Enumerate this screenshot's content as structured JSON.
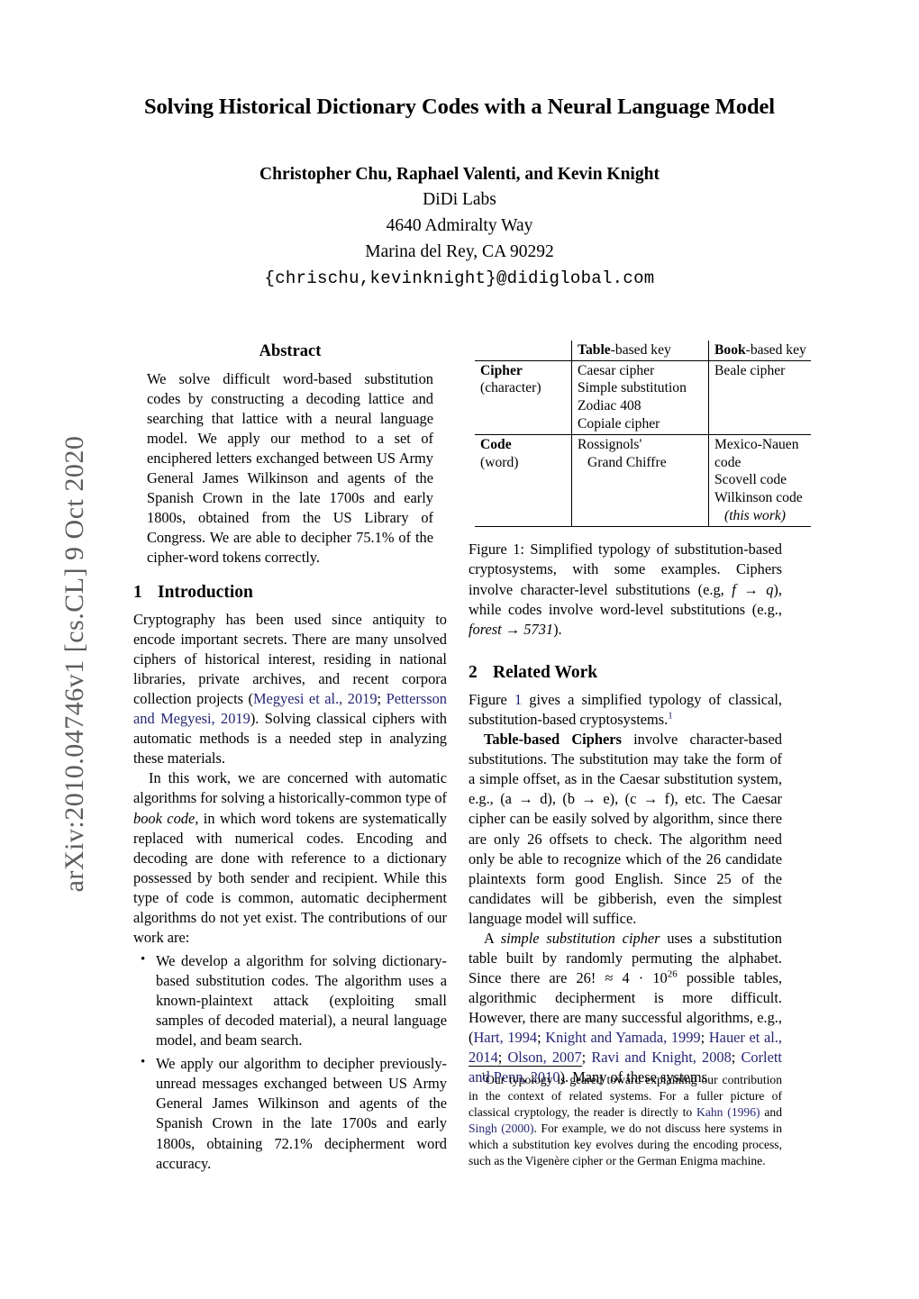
{
  "arxiv_stamp": "arXiv:2010.04746v1  [cs.CL]  9 Oct 2020",
  "title": "Solving Historical Dictionary Codes with a Neural Language Model",
  "authors": {
    "names": "Christopher Chu, Raphael Valenti, and Kevin Knight",
    "org": "DiDi Labs",
    "street": "4640 Admiralty Way",
    "city": "Marina del Rey, CA 90292",
    "email": "{chrischu,kevinknight}@didiglobal.com"
  },
  "abstract": {
    "heading": "Abstract",
    "body": "We solve difficult word-based substitution codes by constructing a decoding lattice and searching that lattice with a neural language model. We apply our method to a set of enciphered letters exchanged between US Army General James Wilkinson and agents of the Spanish Crown in the late 1700s and early 1800s, obtained from the US Library of Congress. We are able to decipher 75.1% of the cipher-word tokens correctly."
  },
  "sections": {
    "intro": {
      "number": "1",
      "title": "Introduction",
      "para1_a": "Cryptography has been used since antiquity to encode important secrets. There are many unsolved ciphers of historical interest, residing in national libraries, private archives, and recent corpora collection projects (",
      "para1_cite1": "Megyesi et al., 2019",
      "para1_sep": "; ",
      "para1_cite2": "Pettersson and Megyesi, 2019",
      "para1_b": "). Solving classical ciphers with automatic methods is a needed step in analyzing these materials.",
      "para2_a": "In this work, we are concerned with automatic algorithms for solving a historically-common type of ",
      "para2_em": "book code",
      "para2_b": ", in which word tokens are systematically replaced with numerical codes. Encoding and decoding are done with reference to a dictionary possessed by both sender and recipient. While this type of code is common, automatic decipherment algorithms do not yet exist. The contributions of our work are:",
      "bullets": [
        "We develop a algorithm for solving dictionary-based substitution codes. The algorithm uses a known-plaintext attack (exploiting small samples of decoded material), a neural language model, and beam search.",
        "We apply our algorithm to decipher previously-unread messages exchanged between US Army General James Wilkinson and agents of the Spanish Crown in the late 1700s and early 1800s, obtaining 72.1% decipherment word accuracy."
      ]
    },
    "related": {
      "number": "2",
      "title": "Related Work",
      "para1_a": "Figure ",
      "para1_ref": "1",
      "para1_b": " gives a simplified typology of classical, substitution-based cryptosystems.",
      "para1_fn": "1",
      "para2_lead": "Table-based Ciphers",
      "para2_a": " involve character-based substitutions. The substitution may take the form of a simple offset, as in the Caesar substitution system, e.g., (a → d), (b → e), (c → f), etc. The Caesar cipher can be easily solved by algorithm, since there are only 26 offsets to check. The algorithm need only be able to recognize which of the 26 candidate plaintexts form good English. Since 25 of the candidates will be gibberish, even the simplest language model will suffice.",
      "para3_a": "A ",
      "para3_em": "simple substitution cipher",
      "para3_b": " uses a substitution table built by randomly permuting the alphabet. Since there are 26! ≈ 4 · 10",
      "para3_exp": "26",
      "para3_c": " possible tables, algorithmic decipherment is more difficult. However, there are many successful algorithms, e.g., (",
      "para3_cites": [
        "Hart, 1994",
        "Knight and Yamada, 1999",
        "Hauer et al., 2014",
        "Olson, 2007",
        "Ravi and Knight, 2008",
        "Corlett and Penn, 2010"
      ],
      "para3_d": "). Many of these systems"
    }
  },
  "figure1": {
    "table": {
      "corner": "",
      "col_headers": [
        {
          "bold": "Table",
          "rest": "-based key"
        },
        {
          "bold": "Book",
          "rest": "-based key"
        }
      ],
      "rows": [
        {
          "label_bold": "Cipher",
          "label_sub": "(character)",
          "table_based": [
            "Caesar cipher",
            "Simple substitution",
            "Zodiac 408",
            "Copiale cipher"
          ],
          "book_based": [
            "Beale cipher"
          ]
        },
        {
          "label_bold": "Code",
          "label_sub": "(word)",
          "table_based": [
            "Rossignols'",
            "Grand Chiffre"
          ],
          "book_based": [
            "Mexico-Nauen code",
            "Scovell code",
            "Wilkinson code",
            "(this work)"
          ]
        }
      ]
    },
    "caption_label": "Figure 1:",
    "caption_a": " Simplified typology of substitution-based cryptosystems, with some examples. Ciphers involve character-level substitutions (e.g, ",
    "caption_math1": "f → q",
    "caption_b": "), while codes involve word-level substitutions (e.g., ",
    "caption_math2": "forest → 5731",
    "caption_c": ")."
  },
  "footnote": {
    "marker": "1",
    "text_a": "Our typology is geared toward explaining our contribution in the context of related systems. For a fuller picture of classical cryptology, the reader is directly to ",
    "cite1": "Kahn",
    "cite1_year": "(1996)",
    "text_b": " and ",
    "cite2": "Singh",
    "cite2_year": "(2000)",
    "text_c": ". For example, we do not discuss here systems in which a substitution key evolves during the encoding process, such as the Vigenère cipher or the German Enigma machine."
  },
  "colors": {
    "link": "#262673",
    "text": "#000000",
    "stamp": "#5d5d5d"
  }
}
